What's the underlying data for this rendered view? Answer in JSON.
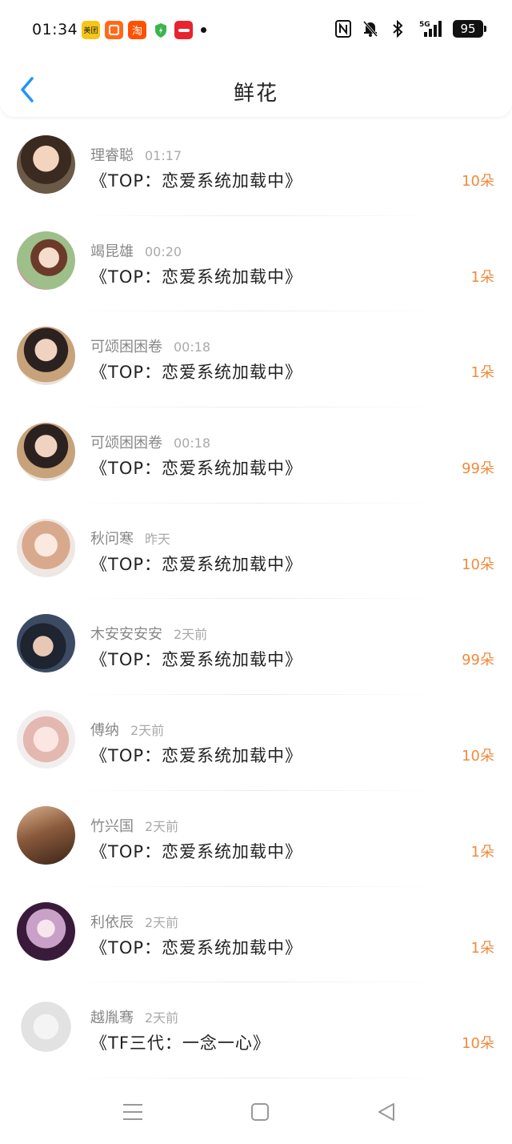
{
  "status_bar": {
    "time": "01:34",
    "app_icons": [
      {
        "name": "meituan-app-icon",
        "label": "美团",
        "color": "#f5c518"
      },
      {
        "name": "app-orange-icon",
        "label": "",
        "color": "#ff6a1a"
      },
      {
        "name": "taobao-app-icon",
        "label": "淘",
        "color": "#ff5000"
      },
      {
        "name": "shield-app-icon",
        "label": "",
        "color": "#3bb54a"
      },
      {
        "name": "red-app-icon",
        "label": "",
        "color": "#e8232f"
      }
    ],
    "network": "5G",
    "battery": "95"
  },
  "header": {
    "title": "鲜花",
    "accent": "#2196f3"
  },
  "colors": {
    "amount": "#f08a3c"
  },
  "items": [
    {
      "name": "理睿聪",
      "time": "01:17",
      "title": "《TOP：恋爱系统加载中》",
      "amount": "10朵"
    },
    {
      "name": "竭昆雄",
      "time": "00:20",
      "title": "《TOP：恋爱系统加载中》",
      "amount": "1朵"
    },
    {
      "name": "可颂困困卷",
      "time": "00:18",
      "title": "《TOP：恋爱系统加载中》",
      "amount": "1朵"
    },
    {
      "name": "可颂困困卷",
      "time": "00:18",
      "title": "《TOP：恋爱系统加载中》",
      "amount": "99朵"
    },
    {
      "name": "秋问寒",
      "time": "昨天",
      "title": "《TOP：恋爱系统加载中》",
      "amount": "10朵"
    },
    {
      "name": "木安安安安",
      "time": "2天前",
      "title": "《TOP：恋爱系统加载中》",
      "amount": "99朵"
    },
    {
      "name": "傅纳",
      "time": "2天前",
      "title": "《TOP：恋爱系统加载中》",
      "amount": "10朵"
    },
    {
      "name": "竹兴国",
      "time": "2天前",
      "title": "《TOP：恋爱系统加载中》",
      "amount": "1朵"
    },
    {
      "name": "利依辰",
      "time": "2天前",
      "title": "《TOP：恋爱系统加载中》",
      "amount": "1朵"
    },
    {
      "name": "越胤骞",
      "time": "2天前",
      "title": "《TF三代：一念一心》",
      "amount": "10朵"
    }
  ],
  "bottom_nav": [
    "menu-icon",
    "home-icon",
    "back-triangle-icon"
  ]
}
